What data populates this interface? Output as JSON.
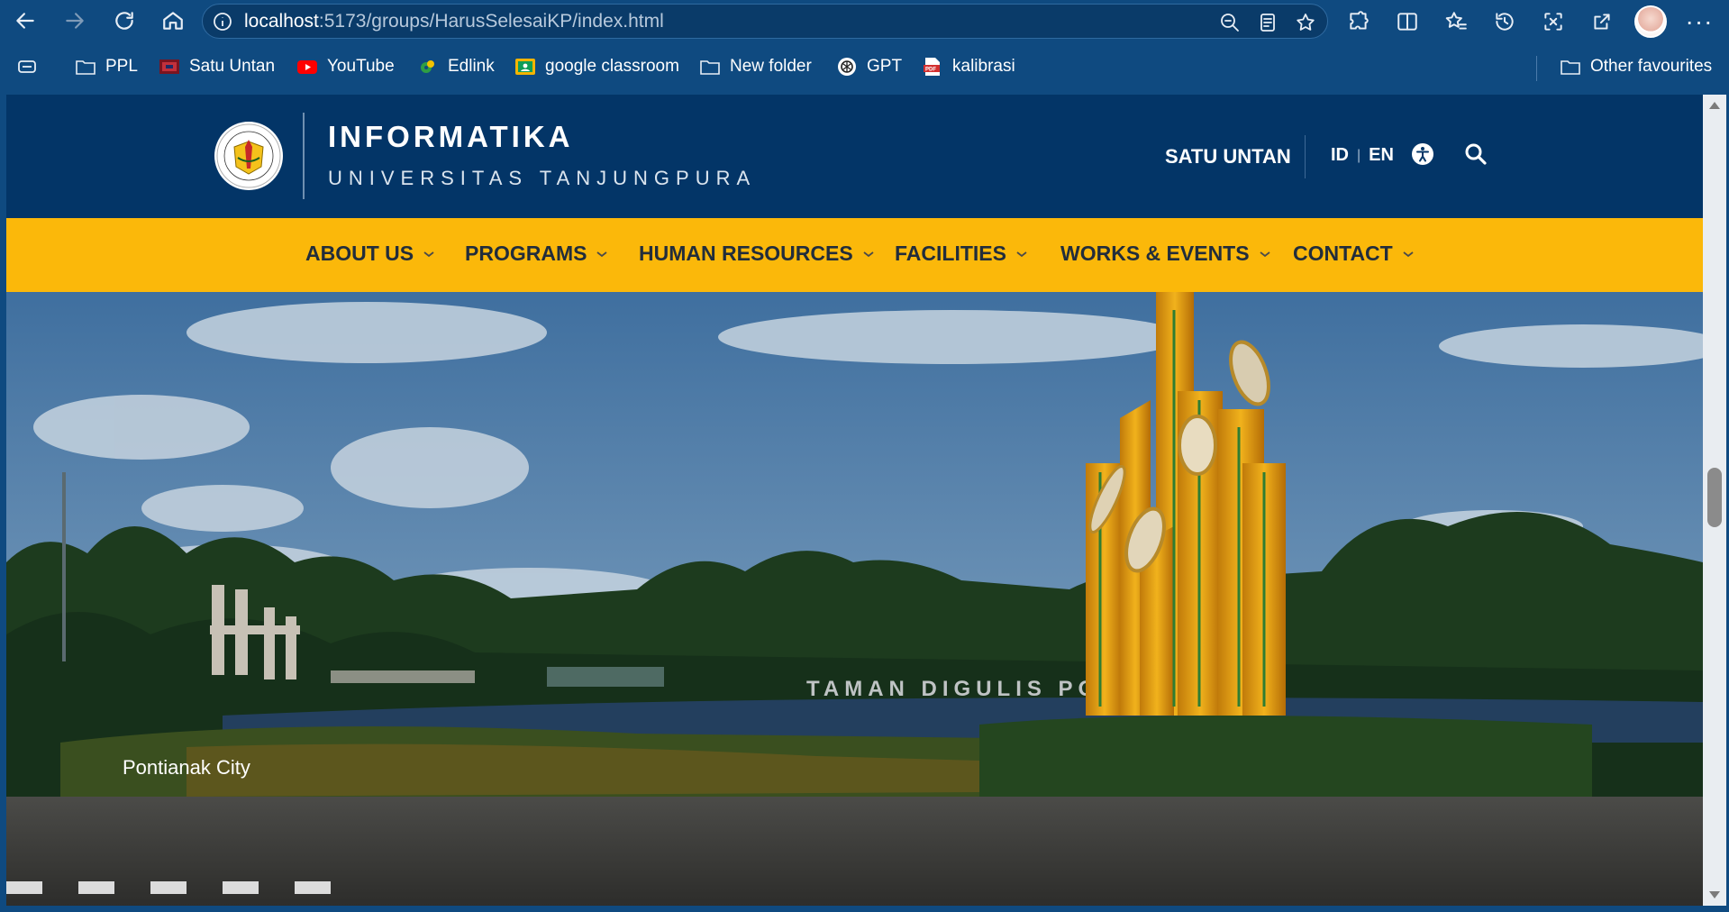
{
  "browser": {
    "url_host": "localhost",
    "url_path": ":5173/groups/HarusSelesaiKP/index.html",
    "bookmarks": [
      {
        "label": "PPL",
        "icon": "folder-icon"
      },
      {
        "label": "Satu Untan",
        "icon": "satu-untan-favicon"
      },
      {
        "label": "YouTube",
        "icon": "youtube-icon"
      },
      {
        "label": "Edlink",
        "icon": "edlink-icon"
      },
      {
        "label": "google classroom",
        "icon": "google-classroom-icon"
      },
      {
        "label": "New folder",
        "icon": "folder-icon"
      },
      {
        "label": "GPT",
        "icon": "openai-icon"
      },
      {
        "label": "kalibrasi",
        "icon": "pdf-icon"
      }
    ],
    "other_favourites": "Other favourites"
  },
  "site": {
    "brand_title": "INFORMATIKA",
    "brand_subtitle": "UNIVERSITAS TANJUNGPURA",
    "satu_untan": "SATU UNTAN",
    "lang_id": "ID",
    "lang_sep": "|",
    "lang_en": "EN",
    "nav": [
      {
        "label": "ABOUT US"
      },
      {
        "label": "PROGRAMS"
      },
      {
        "label": "HUMAN RESOURCES"
      },
      {
        "label": "FACILITIES"
      },
      {
        "label": "WORKS & EVENTS"
      },
      {
        "label": "CONTACT"
      }
    ],
    "hero_caption": "Pontianak City",
    "hero_sign": "TAMAN DIGULIS PON"
  },
  "colors": {
    "chrome": "#0f4a80",
    "header": "#033567",
    "nav": "#fbb80a"
  }
}
